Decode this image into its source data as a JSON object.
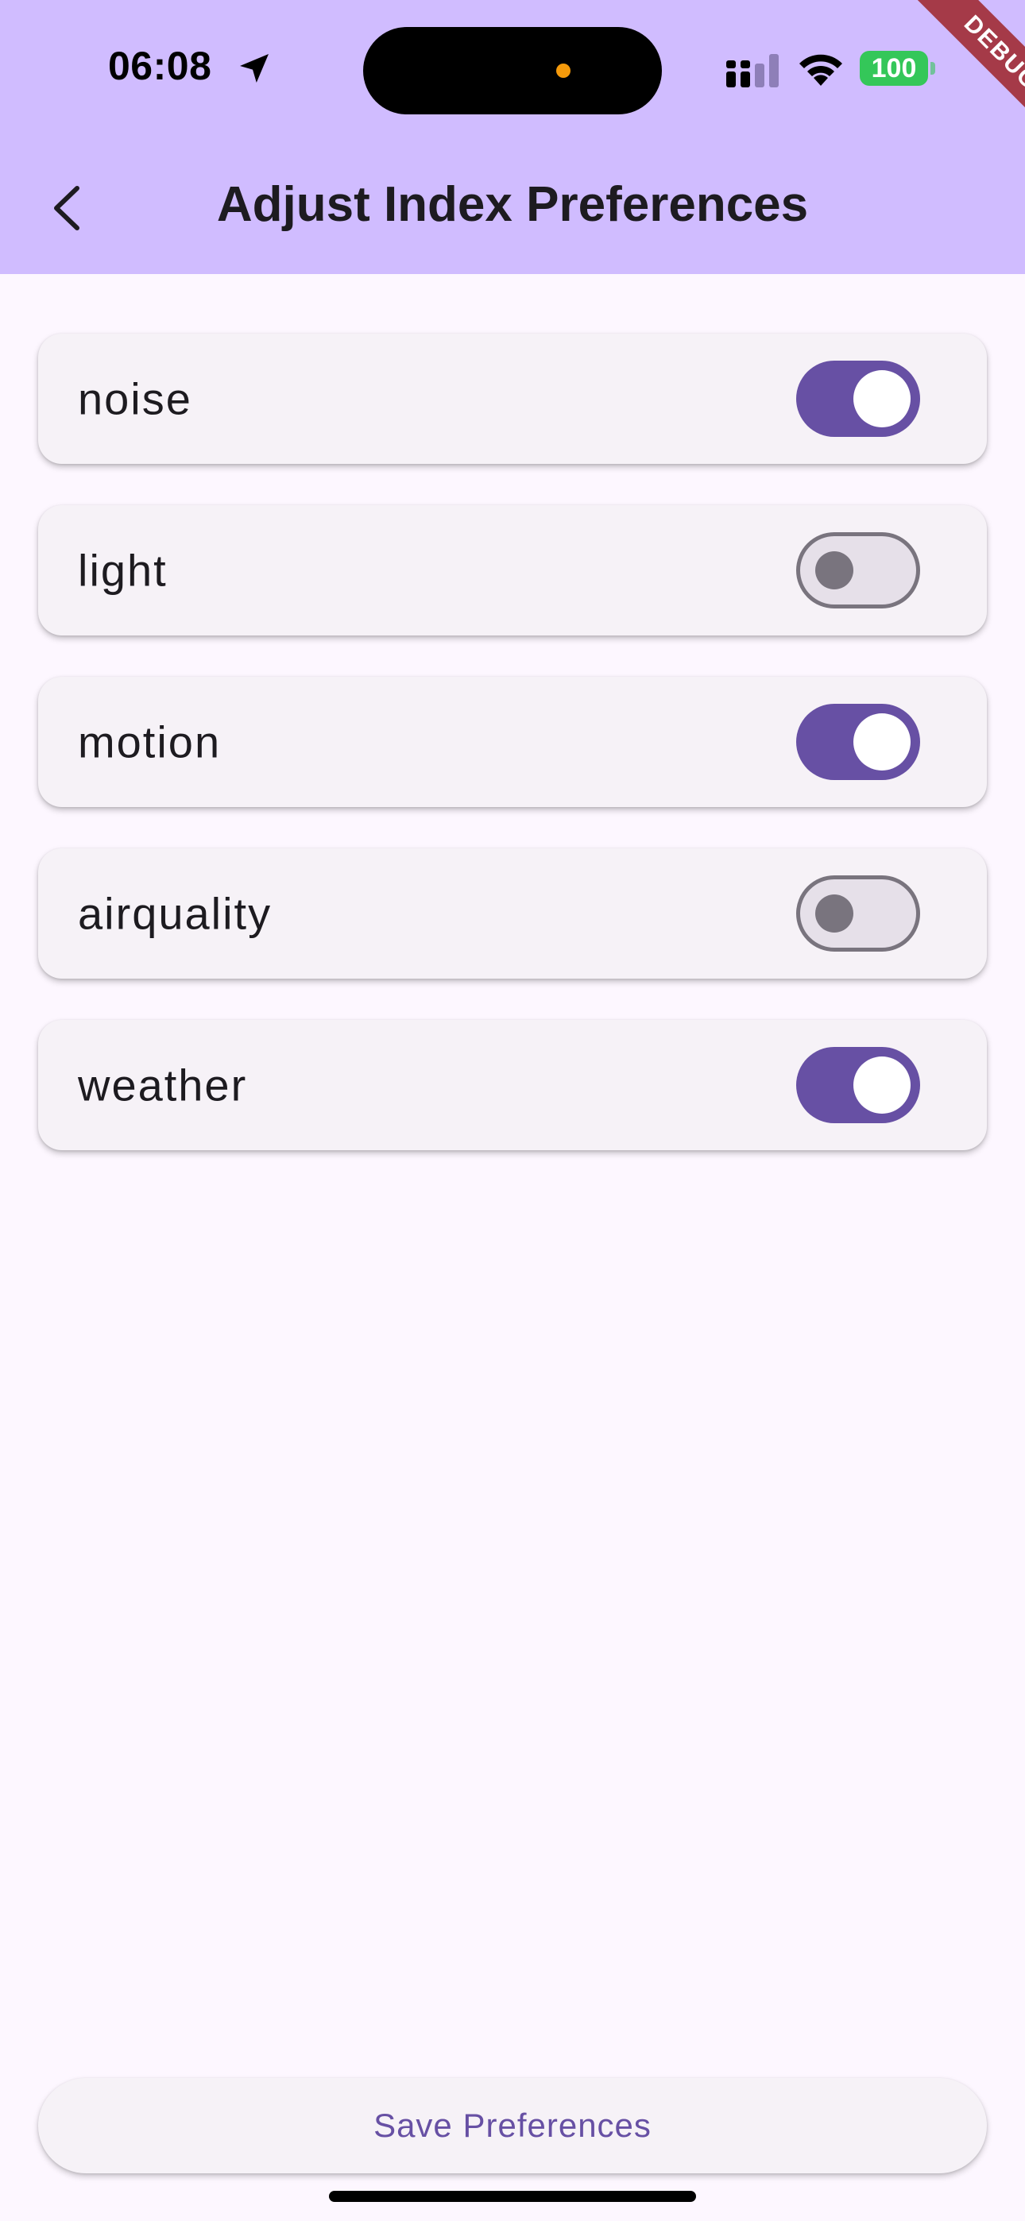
{
  "status_bar": {
    "time": "06:08",
    "battery": "100",
    "battery_color": "#34c759"
  },
  "debug_banner": "DEBUG",
  "app_bar": {
    "title": "Adjust Index Preferences",
    "back_icon": "chevron-left-icon",
    "background": "#d0bcff"
  },
  "preferences": [
    {
      "label": "noise",
      "enabled": true
    },
    {
      "label": "light",
      "enabled": false
    },
    {
      "label": "motion",
      "enabled": true
    },
    {
      "label": "airquality",
      "enabled": false
    },
    {
      "label": "weather",
      "enabled": true
    }
  ],
  "save_button": {
    "label": "Save Preferences"
  },
  "colors": {
    "accent": "#6750a4",
    "switch_off_track": "#e6e0e9",
    "switch_off_outline": "#79747e",
    "card": "#f6f2f7",
    "page_background": "#fdf7ff"
  }
}
